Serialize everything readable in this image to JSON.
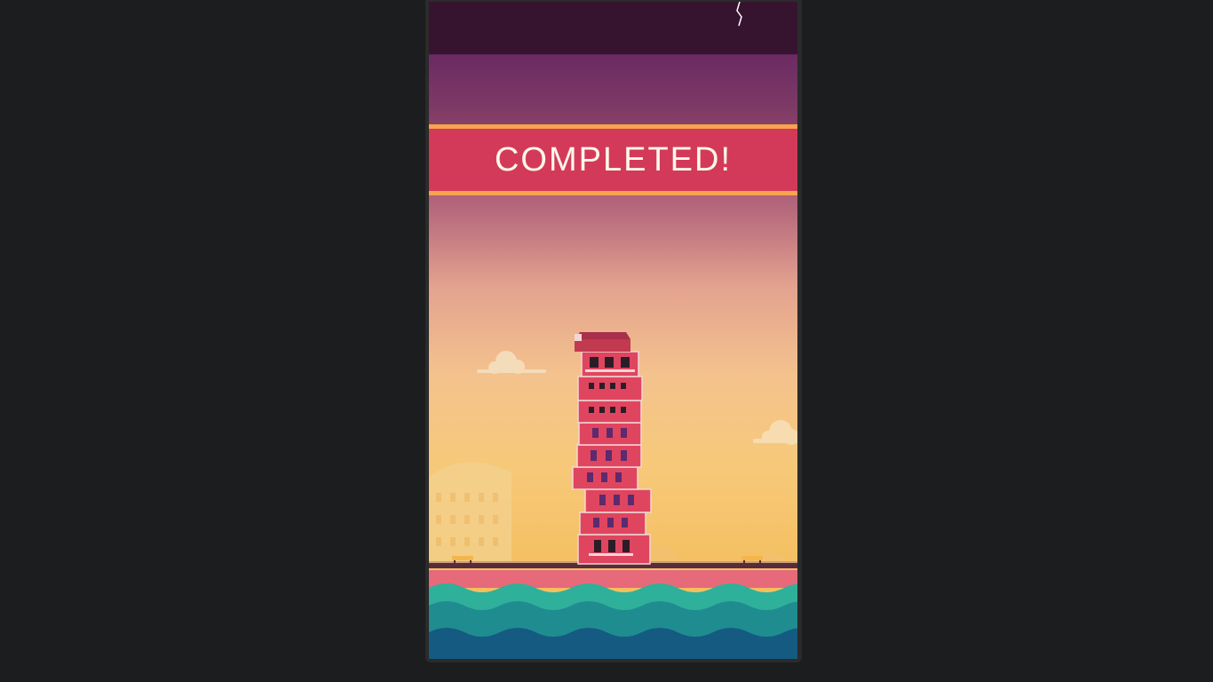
{
  "game": {
    "status_text": "COMPLETED!",
    "floor_count": 10
  },
  "colors": {
    "banner": "#d33a5a",
    "banner_trim": "#f7a44e",
    "building": "#e0455f",
    "water_light": "#2fb09a",
    "water_deep": "#155a80"
  },
  "icons": [
    "lightning-icon",
    "cloud-icon",
    "tower-icon",
    "barrier-icon",
    "waves-icon"
  ]
}
